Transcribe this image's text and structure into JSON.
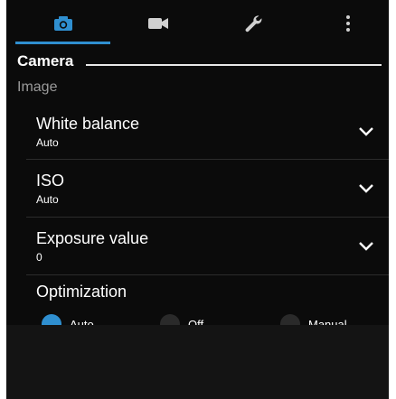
{
  "tabs": [
    {
      "icon": "camera-icon",
      "active": true
    },
    {
      "icon": "video-camera-icon",
      "active": false
    },
    {
      "icon": "wrench-icon",
      "active": false
    },
    {
      "icon": "more-vertical-icon",
      "active": false
    }
  ],
  "colors": {
    "accent": "#2f8fd0",
    "background": "#0b0b0b",
    "tab_icon_inactive": "#d0d0d0",
    "subheader_text": "#9a9a9a"
  },
  "section": {
    "title": "Camera"
  },
  "subheader": "Image",
  "settings": [
    {
      "label": "White balance",
      "value": "Auto"
    },
    {
      "label": "ISO",
      "value": "Auto"
    },
    {
      "label": "Exposure value",
      "value": "0"
    }
  ],
  "optimization": {
    "title": "Optimization",
    "options": [
      {
        "label": "Auto",
        "selected": true
      },
      {
        "label": "Off",
        "selected": false
      },
      {
        "label": "Manual",
        "selected": false
      }
    ]
  }
}
